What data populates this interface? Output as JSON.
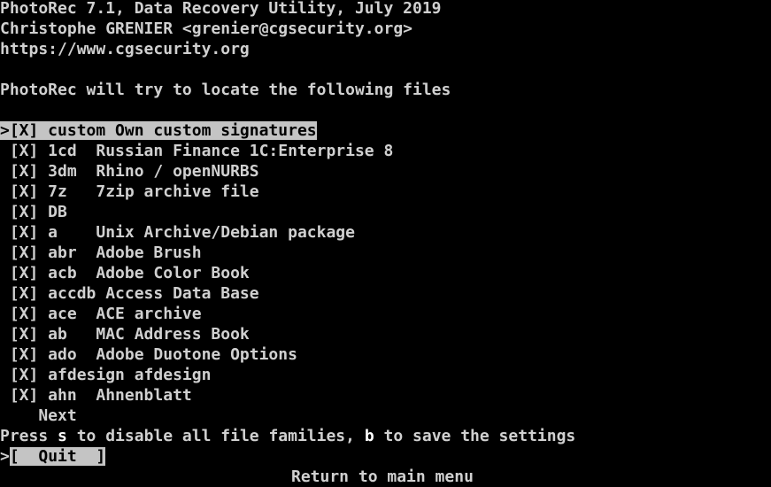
{
  "header": {
    "title": "PhotoRec 7.1, Data Recovery Utility, July 2019",
    "author": "Christophe GRENIER <grenier@cgsecurity.org>",
    "url": "https://www.cgsecurity.org"
  },
  "intro": "PhotoRec will try to locate the following files",
  "file_list": {
    "selected_item": ">[X] custom Own custom signatures",
    "items": [
      " [X] 1cd  Russian Finance 1C:Enterprise 8",
      " [X] 3dm  Rhino / openNURBS",
      " [X] 7z   7zip archive file",
      " [X] DB",
      " [X] a    Unix Archive/Debian package",
      " [X] abr  Adobe Brush",
      " [X] acb  Adobe Color Book",
      " [X] accdb Access Data Base",
      " [X] ace  ACE archive",
      " [X] ab   MAC Address Book",
      " [X] ado  Adobe Duotone Options",
      " [X] afdesign afdesign",
      " [X] ahn  Ahnenblatt"
    ],
    "next_label": "    Next"
  },
  "help": {
    "prefix": "Press ",
    "key_s": "s",
    "middle": " to disable all file families, ",
    "key_b": "b",
    "suffix": " to save the settings"
  },
  "menu": {
    "cursor": ">",
    "quit_label": "[  Quit  ]",
    "quit_description": "Return to main menu"
  },
  "colors": {
    "background": "#000000",
    "text": "#d0d0d0",
    "highlight_bg": "#c4c4c4",
    "highlight_fg": "#000000"
  }
}
